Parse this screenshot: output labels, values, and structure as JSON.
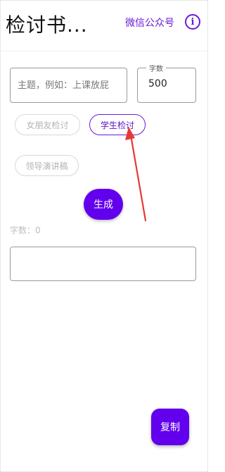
{
  "header": {
    "title": "检讨书...",
    "wechat_label": "微信公众号",
    "info_icon": "info-icon",
    "info_glyph": "i"
  },
  "form": {
    "topic_placeholder": "主题，例如：上课放屁",
    "topic_value": "",
    "word_count_label": "字数",
    "word_count_value": "500"
  },
  "chips": [
    {
      "label": "女朋友检讨",
      "selected": false
    },
    {
      "label": "学生检讨",
      "selected": true
    },
    {
      "label": "领导演讲稿",
      "selected": false
    }
  ],
  "actions": {
    "generate_label": "生成",
    "copy_label": "复制"
  },
  "result": {
    "word_count_text": "字数：0",
    "content": ""
  },
  "colors": {
    "accent": "#6200ee",
    "accent_text": "#6a1bd6",
    "annotation_arrow": "#e53935"
  }
}
